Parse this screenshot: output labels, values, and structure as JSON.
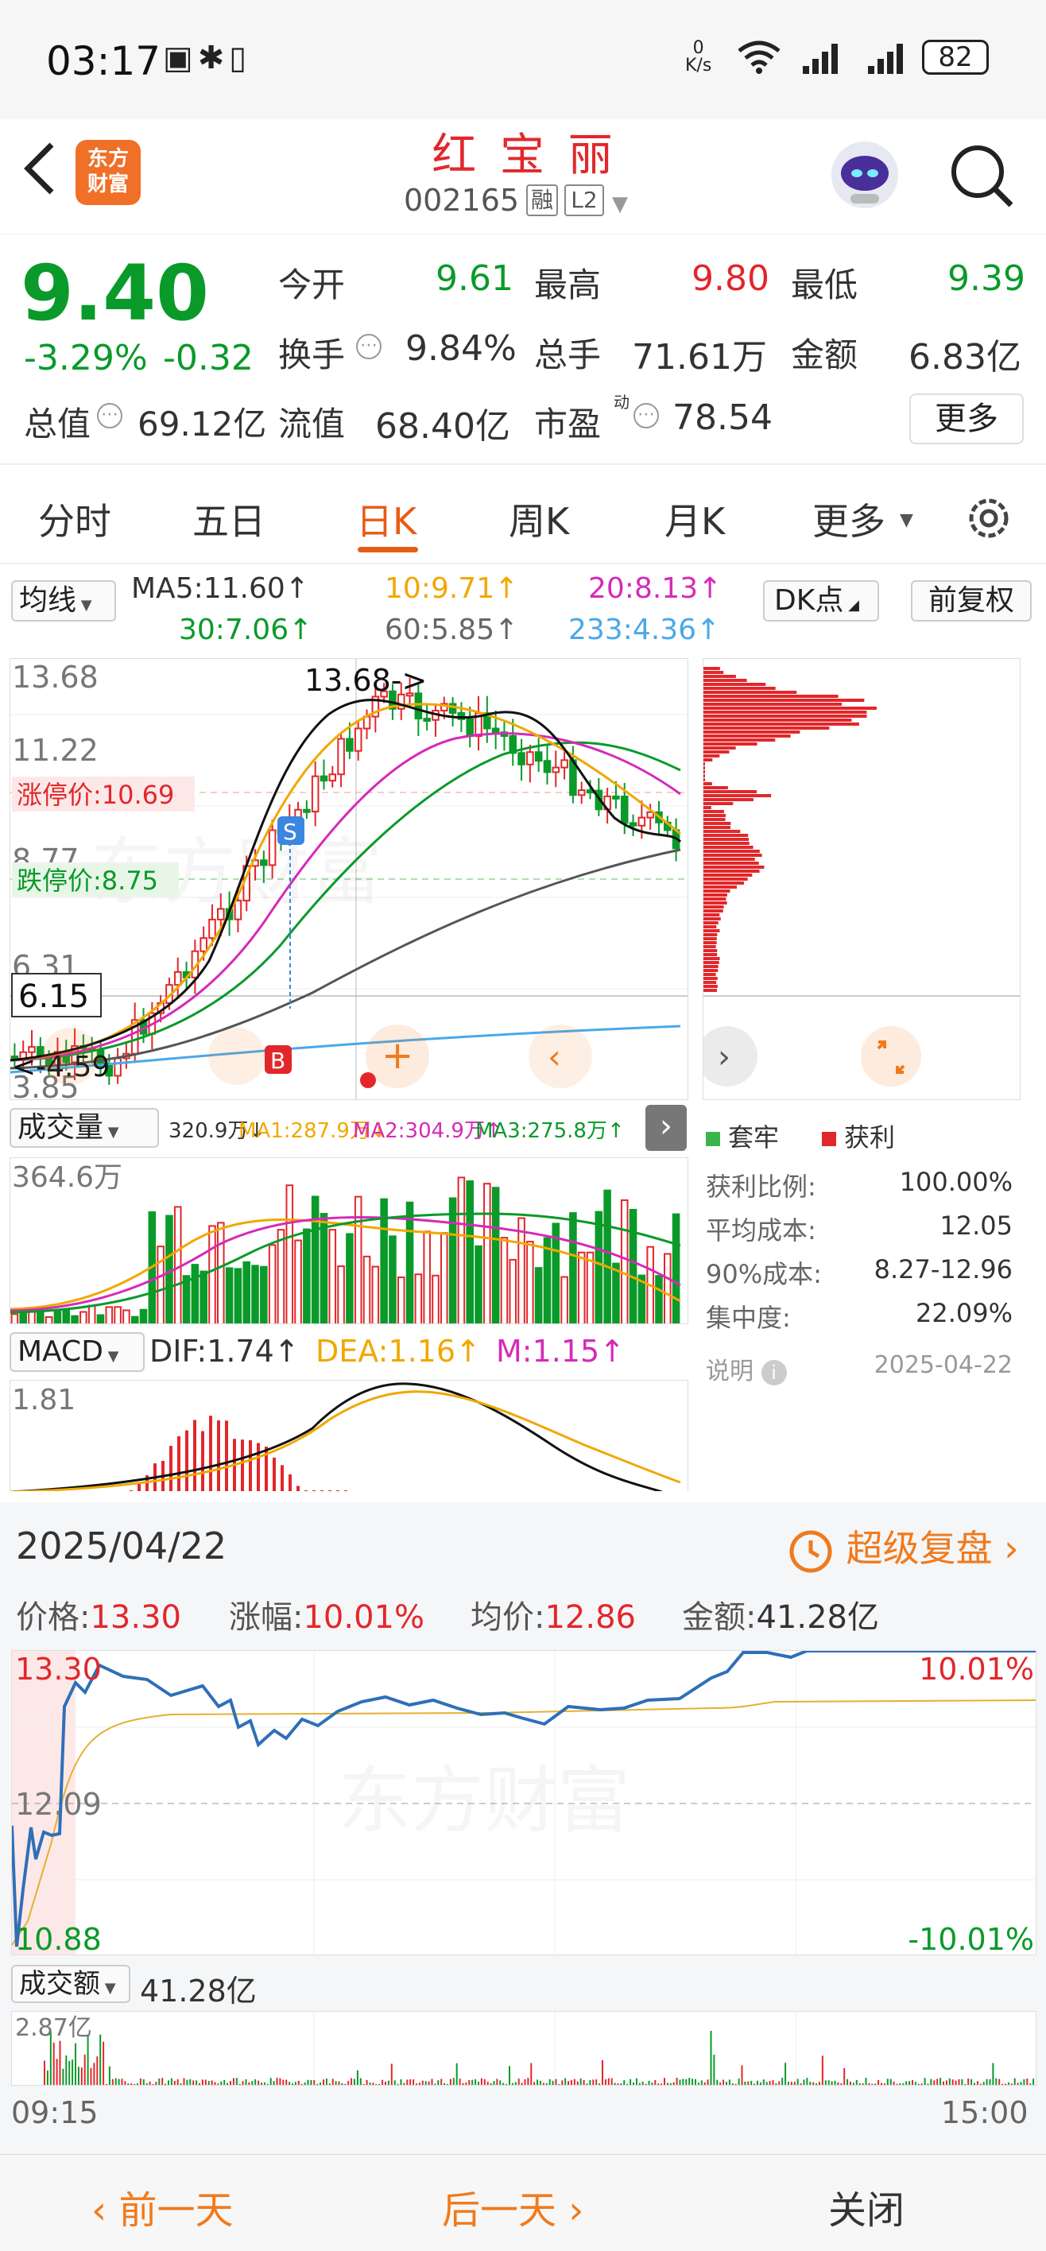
{
  "status_bar": {
    "time": "03:17",
    "net_rate_top": "0",
    "net_rate_unit": "K/s",
    "battery": "82"
  },
  "header": {
    "back_icon": "back-arrow-icon",
    "logo_line1": "东方",
    "logo_line2": "财富",
    "stock_name": "红 宝 丽",
    "stock_code": "002165",
    "tag_margin": "融",
    "tag_level": "L2"
  },
  "quote": {
    "price": "9.40",
    "change_pct": "-3.29%",
    "change_amt": "-0.32",
    "open_label": "今开",
    "open": "9.61",
    "high_label": "最高",
    "high": "9.80",
    "low_label": "最低",
    "low": "9.39",
    "turnover_label": "换手",
    "turnover": "9.84%",
    "volume_label": "总手",
    "volume": "71.61万",
    "amount_label": "金额",
    "amount": "6.83亿",
    "mcap_label": "总值",
    "mcap": "69.12亿",
    "float_label": "流值",
    "float": "68.40亿",
    "pe_label": "市盈",
    "pe_sup": "动",
    "pe": "78.54",
    "more": "更多"
  },
  "tabs": [
    "分时",
    "五日",
    "日K",
    "周K",
    "月K",
    "更多"
  ],
  "ma_bar": {
    "selector": "均线",
    "ma5": "MA5:11.60↑",
    "ma10": "10:9.71↑",
    "ma20": "20:8.13↑",
    "ma30": "30:7.06↑",
    "ma60": "60:5.85↑",
    "ma233": "233:4.36↑",
    "dk": "DK点",
    "adjust": "前复权"
  },
  "kline": {
    "y_labels": [
      "13.68",
      "11.22",
      "8.77",
      "6.31",
      "3.85"
    ],
    "peak_label": "13.68->",
    "limit_up": "涨停价:10.69",
    "limit_down": "跌停价:8.75",
    "cursor_price": "6.15",
    "low_label": "<-4.59",
    "s_marker": "S",
    "b_marker": "B"
  },
  "volume_bar": {
    "selector": "成交量",
    "vol": "320.9万↓",
    "ma1": "MA1:287.9万↓",
    "ma2": "MA2:304.9万↑",
    "ma3": "MA3:275.8万↑",
    "y_label": "364.6万"
  },
  "macd_bar": {
    "selector": "MACD",
    "dif": "DIF:1.74↑",
    "dea": "DEA:1.16↑",
    "m": "M:1.15↑",
    "y_label": "1.81"
  },
  "chip": {
    "legend_trap": "套牢",
    "legend_profit": "获利",
    "rows": [
      [
        "获利比例:",
        "100.00%"
      ],
      [
        "平均成本:",
        "12.05"
      ],
      [
        "90%成本:",
        "8.27-12.96"
      ],
      [
        "集中度:",
        "22.09%"
      ]
    ],
    "note": "说明",
    "date": "2025-04-22"
  },
  "intraday": {
    "date": "2025/04/22",
    "super_replay": "超级复盘",
    "price_label": "价格:",
    "price": "13.30",
    "pct_label": "涨幅:",
    "pct": "10.01%",
    "avg_label": "均价:",
    "avg": "12.86",
    "amount_label": "金额:",
    "amount": "41.28亿",
    "y_top": "13.30",
    "y_mid": "12.09",
    "y_bot": "10.88",
    "pct_top": "10.01%",
    "pct_bot": "-10.01%",
    "amount_selector": "成交额",
    "amount_total": "41.28亿",
    "amount_y": "2.87亿",
    "t_start": "09:15",
    "t_end": "15:00"
  },
  "bottom": {
    "prev": "前一天",
    "next": "后一天",
    "close": "关闭"
  },
  "colors": {
    "up": "#e2272b",
    "down": "#0a9a2a",
    "accent": "#e85d14"
  }
}
